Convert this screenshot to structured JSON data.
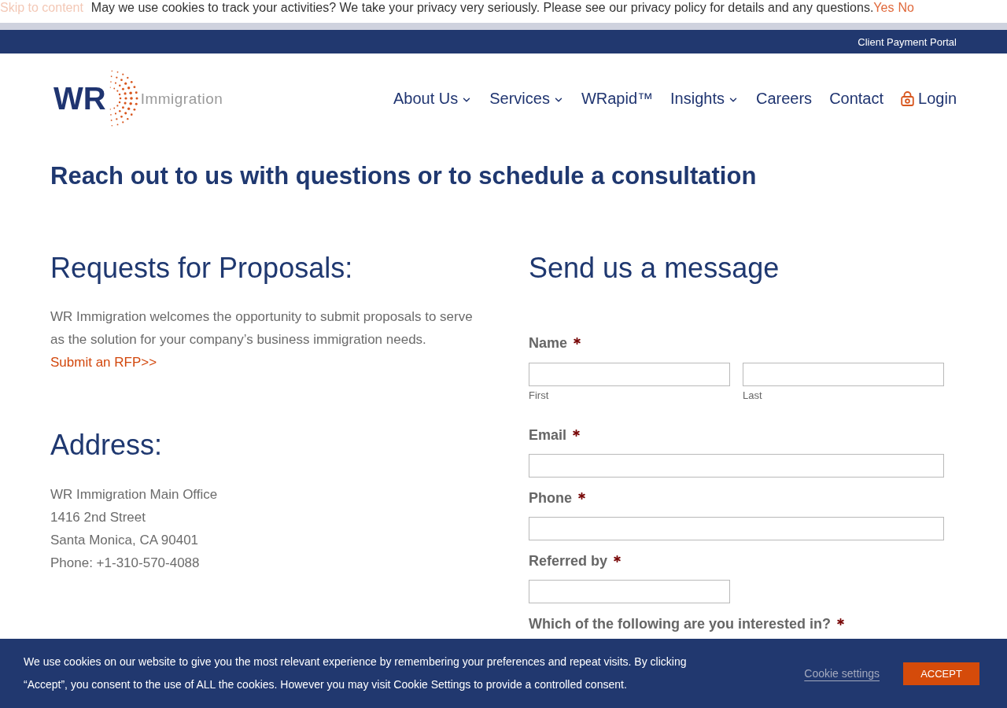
{
  "cookie_notice": {
    "skip_link": "Skip to content",
    "text": "May we use cookies to track your activities? We take your privacy very seriously. Please see our privacy policy for details and any questions.",
    "yes": "Yes",
    "no": "No"
  },
  "top_bar": {
    "link": "Client Payment Portal"
  },
  "header": {
    "logo": {
      "mark": "WR",
      "name": "Immigration"
    },
    "nav": [
      {
        "label": "About Us",
        "kind": "menu"
      },
      {
        "label": "Services",
        "kind": "menu"
      },
      {
        "label": "WRapid™",
        "kind": "link"
      },
      {
        "label": "Insights",
        "kind": "menu"
      },
      {
        "label": "Careers",
        "kind": "link"
      },
      {
        "label": "Contact",
        "kind": "link"
      },
      {
        "label": "Login",
        "kind": "login"
      }
    ]
  },
  "headline": "Reach out to us with questions or to schedule a consultation",
  "proposals": {
    "heading": "Requests for Proposals:",
    "text": "WR Immigration welcomes the opportunity to submit proposals to serve as the solution for your company’s business immigration needs.",
    "link": "Submit an RFP>>"
  },
  "address": {
    "heading": "Address:",
    "lines": [
      "WR Immigration Main Office",
      "1416 2nd Street",
      "Santa Monica, CA 90401",
      "Phone: +1-310-570-4088"
    ]
  },
  "form": {
    "heading": "Send us a message",
    "fields": [
      {
        "label": "Name",
        "kind": "name",
        "required": true,
        "parts": [
          {
            "sublabel": "First"
          },
          {
            "sublabel": "Last"
          }
        ]
      },
      {
        "label": "Email",
        "kind": "wide",
        "required": true
      },
      {
        "label": "Phone",
        "kind": "wide",
        "required": true
      },
      {
        "label": "Referred by",
        "kind": "short",
        "required": true
      },
      {
        "label": "Which of the following are you interested in?",
        "kind": "choice",
        "required": true
      }
    ]
  },
  "cookie_banner": {
    "text": "We use cookies on our website to give you the most relevant experience by remembering your preferences and repeat visits. By clicking “Accept”, you consent to the use of ALL the cookies. However you may visit Cookie Settings to provide a controlled consent.",
    "settings_link": "Cookie settings",
    "accept": "ACCEPT"
  }
}
